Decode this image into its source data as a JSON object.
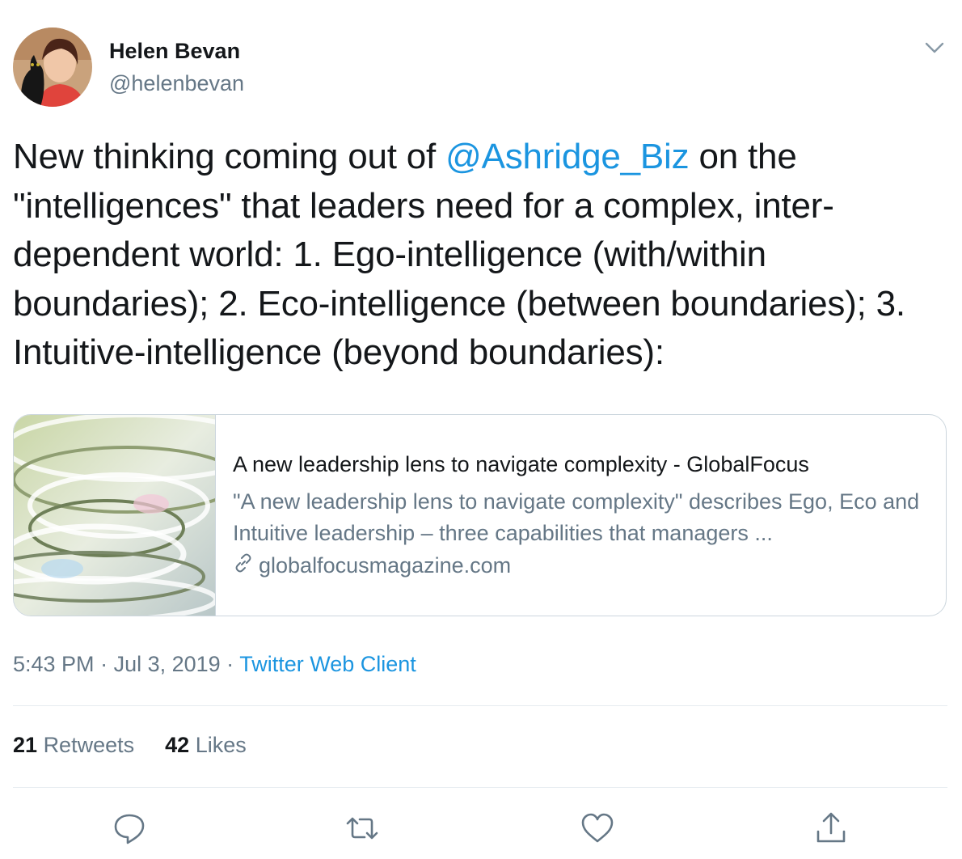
{
  "author": {
    "name": "Helen Bevan",
    "handle": "@helenbevan"
  },
  "tweet": {
    "text_before": "New thinking coming out of ",
    "mention": "@Ashridge_Biz",
    "text_after": " on the \"intelligences\" that leaders need for a complex, inter-dependent world: 1. Ego-intelligence (with/within boundaries); 2. Eco-intelligence (between boundaries); 3. Intuitive-intelligence (beyond boundaries):"
  },
  "card": {
    "title": "A new leadership lens to navigate complexity - GlobalFocus",
    "description": "\"A new leadership lens to navigate complexity\" describes Ego, Eco and Intuitive leadership – three capabilities that managers ...",
    "domain": "globalfocusmagazine.com",
    "domain_icon": "link-icon",
    "thumbnail": "glass-spiral-image"
  },
  "meta": {
    "time": "5:43 PM",
    "separator": " · ",
    "date": "Jul 3, 2019",
    "source": "Twitter Web Client"
  },
  "stats": {
    "retweets_count": "21",
    "retweets_label": "Retweets",
    "likes_count": "42",
    "likes_label": "Likes"
  },
  "actions": [
    "reply-icon",
    "retweet-icon",
    "like-icon",
    "share-icon"
  ],
  "colors": {
    "link": "#1b95e0",
    "secondary_text": "#657786",
    "primary_text": "#14171a",
    "border": "#ccd6dd"
  }
}
